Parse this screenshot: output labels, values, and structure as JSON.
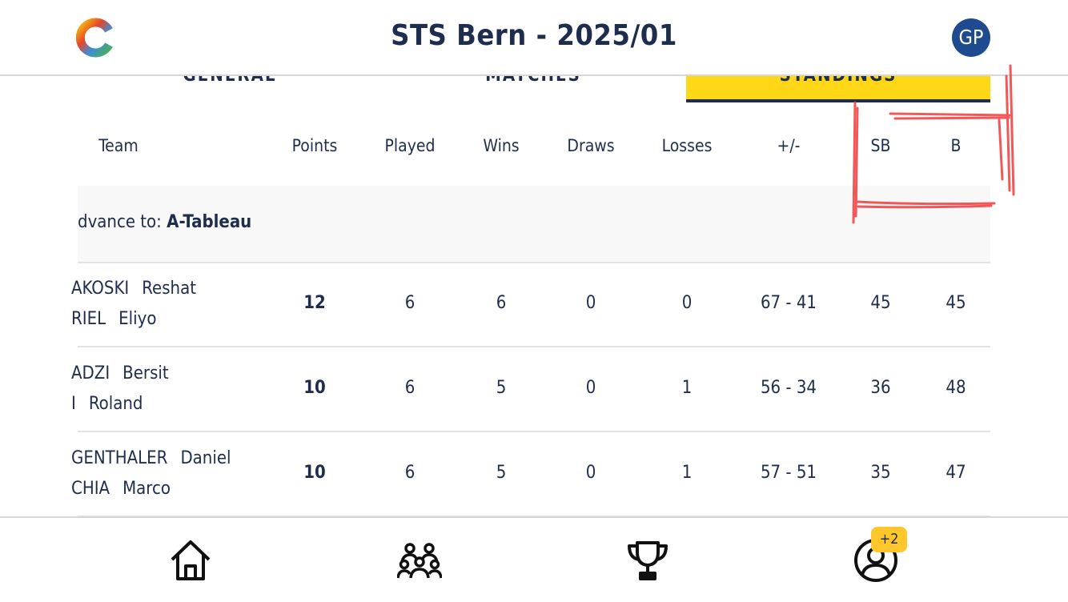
{
  "header": {
    "title": "STS Bern - 2025/01",
    "avatar_initials": "GP"
  },
  "tabs": [
    {
      "label": "GENERAL"
    },
    {
      "label": "MATCHES"
    },
    {
      "label": "STANDINGS"
    }
  ],
  "table": {
    "columns": [
      "Team",
      "Points",
      "Played",
      "Wins",
      "Draws",
      "Losses",
      "+/-",
      "SB",
      "B"
    ],
    "group": {
      "prefix": "dvance to: ",
      "name": "A-Tableau"
    },
    "rows": [
      {
        "player1_last": "AKOSKI",
        "player1_first": "Reshat",
        "player2_last": "RIEL",
        "player2_first": "Eliyo",
        "points": "12",
        "played": "6",
        "wins": "6",
        "draws": "0",
        "losses": "0",
        "diff": "67 - 41",
        "sb": "45",
        "b": "45"
      },
      {
        "player1_last": "ADZI",
        "player1_first": "Bersit",
        "player2_last": "I",
        "player2_first": "Roland",
        "points": "10",
        "played": "6",
        "wins": "5",
        "draws": "0",
        "losses": "1",
        "diff": "56 - 34",
        "sb": "36",
        "b": "48"
      },
      {
        "player1_last": "GENTHALER",
        "player1_first": "Daniel",
        "player2_last": "CHIA",
        "player2_first": "Marco",
        "points": "10",
        "played": "6",
        "wins": "5",
        "draws": "0",
        "losses": "1",
        "diff": "57 - 51",
        "sb": "35",
        "b": "47"
      }
    ]
  },
  "bottom_nav": {
    "items": [
      {
        "icon": "home-icon"
      },
      {
        "icon": "teams-icon"
      },
      {
        "icon": "trophy-icon"
      },
      {
        "icon": "profile-icon"
      }
    ],
    "badge": "+2"
  },
  "colors": {
    "primary": "#1f2d4d",
    "accent": "#ffd717",
    "avatar": "#1e4b8f",
    "badge": "#ffc72c",
    "annotation": "#f03c3c"
  }
}
